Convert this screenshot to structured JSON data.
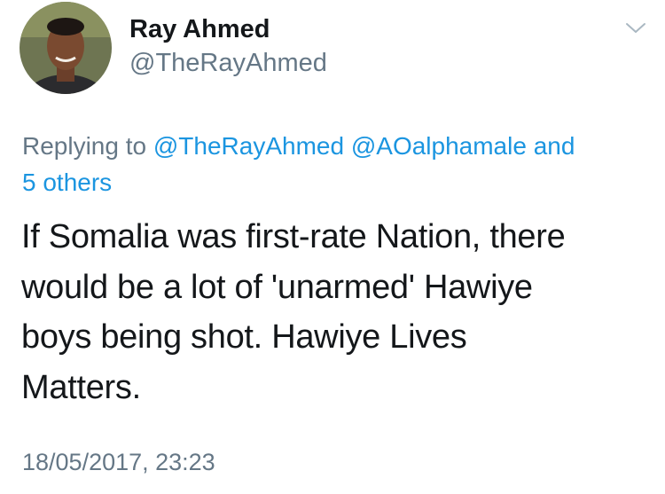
{
  "author": {
    "name": "Ray Ahmed",
    "handle": "@TheRayAhmed"
  },
  "icons": {
    "menu": "chevron-down-icon"
  },
  "reply": {
    "prefix": "Replying to",
    "mentions": [
      "@TheRayAhmed",
      "@AOalphamale"
    ],
    "connector": "and",
    "others": "5 others"
  },
  "tweet": {
    "text_lines": [
      "If Somalia was first-rate Nation, there",
      "would be a lot of 'unarmed' Hawiye",
      "boys being shot. Hawiye Lives",
      "Matters."
    ],
    "timestamp": "18/05/2017, 23:23"
  },
  "colors": {
    "link": "#1b95e0",
    "secondary_text": "#657786",
    "primary_text": "#14171a"
  }
}
